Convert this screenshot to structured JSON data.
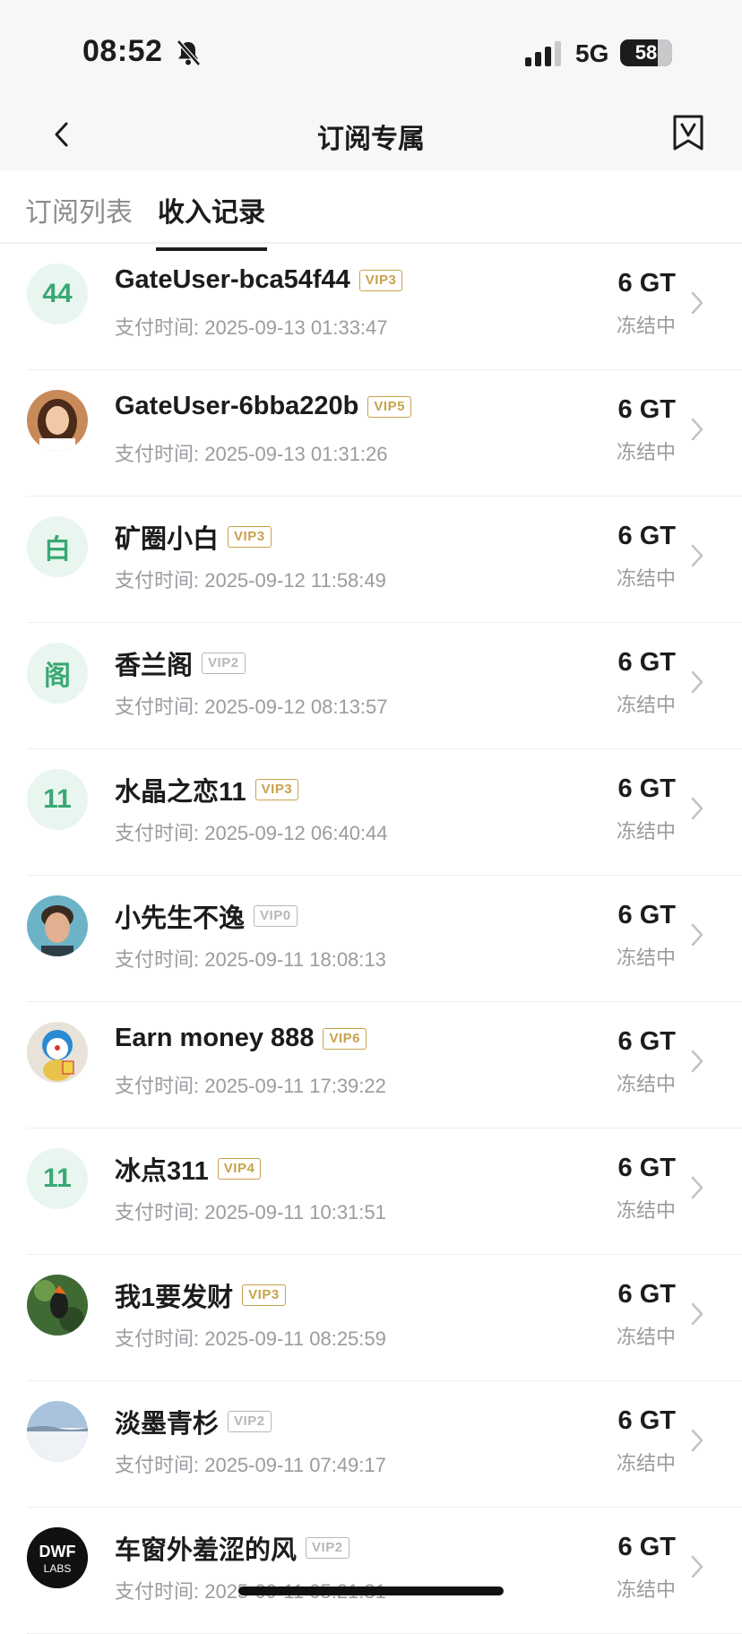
{
  "status_bar": {
    "time": "08:52",
    "network": "5G",
    "battery": "58"
  },
  "nav": {
    "title": "订阅专属"
  },
  "tabs": [
    {
      "label": "订阅列表"
    },
    {
      "label": "收入记录"
    }
  ],
  "colors": {
    "accent_green": "#3aa874",
    "vip_gold": "#c7a24c",
    "vip_gray": "#b7b7bb"
  },
  "records": [
    {
      "name": "GateUser-bca54f44",
      "vip": "VIP3",
      "vip_style": "gold",
      "time": "支付时间: 2025-09-13 01:33:47",
      "amount": "6 GT",
      "status": "冻结中",
      "avatar": {
        "type": "letter",
        "text": "44"
      }
    },
    {
      "name": "GateUser-6bba220b",
      "vip": "VIP5",
      "vip_style": "gold",
      "time": "支付时间: 2025-09-13 01:31:26",
      "amount": "6 GT",
      "status": "冻结中",
      "avatar": {
        "type": "photo",
        "icon": "woman-portrait-avatar"
      }
    },
    {
      "name": "矿圈小白",
      "vip": "VIP3",
      "vip_style": "gold",
      "time": "支付时间: 2025-09-12 11:58:49",
      "amount": "6 GT",
      "status": "冻结中",
      "avatar": {
        "type": "letter",
        "text": "白"
      }
    },
    {
      "name": "香兰阁",
      "vip": "VIP2",
      "vip_style": "gray",
      "time": "支付时间: 2025-09-12 08:13:57",
      "amount": "6 GT",
      "status": "冻结中",
      "avatar": {
        "type": "letter",
        "text": "阁"
      }
    },
    {
      "name": "水晶之恋11",
      "vip": "VIP3",
      "vip_style": "gold",
      "time": "支付时间: 2025-09-12 06:40:44",
      "amount": "6 GT",
      "status": "冻结中",
      "avatar": {
        "type": "letter",
        "text": "11"
      }
    },
    {
      "name": "小先生不逸",
      "vip": "VIP0",
      "vip_style": "gray",
      "time": "支付时间: 2025-09-11 18:08:13",
      "amount": "6 GT",
      "status": "冻结中",
      "avatar": {
        "type": "photo",
        "icon": "man-portrait-avatar"
      }
    },
    {
      "name": "Earn money 888",
      "vip": "VIP6",
      "vip_style": "gold",
      "time": "支付时间: 2025-09-11 17:39:22",
      "amount": "6 GT",
      "status": "冻结中",
      "avatar": {
        "type": "photo",
        "icon": "lucky-cat-avatar"
      }
    },
    {
      "name": "冰点311",
      "vip": "VIP4",
      "vip_style": "gold",
      "time": "支付时间: 2025-09-11 10:31:51",
      "amount": "6 GT",
      "status": "冻结中",
      "avatar": {
        "type": "letter",
        "text": "11"
      }
    },
    {
      "name": "我1要发财",
      "vip": "VIP3",
      "vip_style": "gold",
      "time": "支付时间: 2025-09-11 08:25:59",
      "amount": "6 GT",
      "status": "冻结中",
      "avatar": {
        "type": "photo",
        "icon": "bird-avatar"
      }
    },
    {
      "name": "淡墨青杉",
      "vip": "VIP2",
      "vip_style": "gray",
      "time": "支付时间: 2025-09-11 07:49:17",
      "amount": "6 GT",
      "status": "冻结中",
      "avatar": {
        "type": "photo",
        "icon": "snow-landscape-avatar"
      }
    },
    {
      "name": "车窗外羞涩的风",
      "vip": "VIP2",
      "vip_style": "gray",
      "time": "支付时间: 2025-09-11 05:21:31",
      "amount": "6 GT",
      "status": "冻结中",
      "avatar": {
        "type": "photo",
        "icon": "dwf-labs-logo-avatar",
        "logo_text": "DWF LABS"
      }
    }
  ]
}
